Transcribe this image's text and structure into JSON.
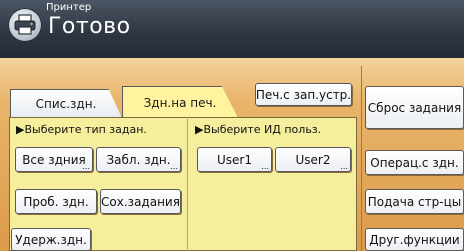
{
  "header": {
    "label": "Принтер",
    "status": "Готово"
  },
  "tabs": [
    {
      "label": "Спис.здн."
    },
    {
      "label": "Здн.на печ."
    }
  ],
  "toolbar": {
    "store_button": "Печ.с зап.устр."
  },
  "sections": {
    "job_type_label": "▶Выберите тип задан.",
    "user_id_label": "▶Выберите ИД польз."
  },
  "job_buttons": {
    "all_jobs": "Все здния",
    "locked_jobs": "Забл. здн.",
    "sample_jobs": "Проб. здн.",
    "saved_jobs": "Сох.задания",
    "hold_jobs": "Удерж.здн."
  },
  "user_buttons": {
    "user1": "User1",
    "user2": "User2"
  },
  "side_buttons": {
    "reset_job": "Сброс задания",
    "operation_jobs": "Операц.с здн.",
    "form_feed": "Подача стр-цы",
    "other_functions": "Друг.функции"
  },
  "ellipsis": "..."
}
